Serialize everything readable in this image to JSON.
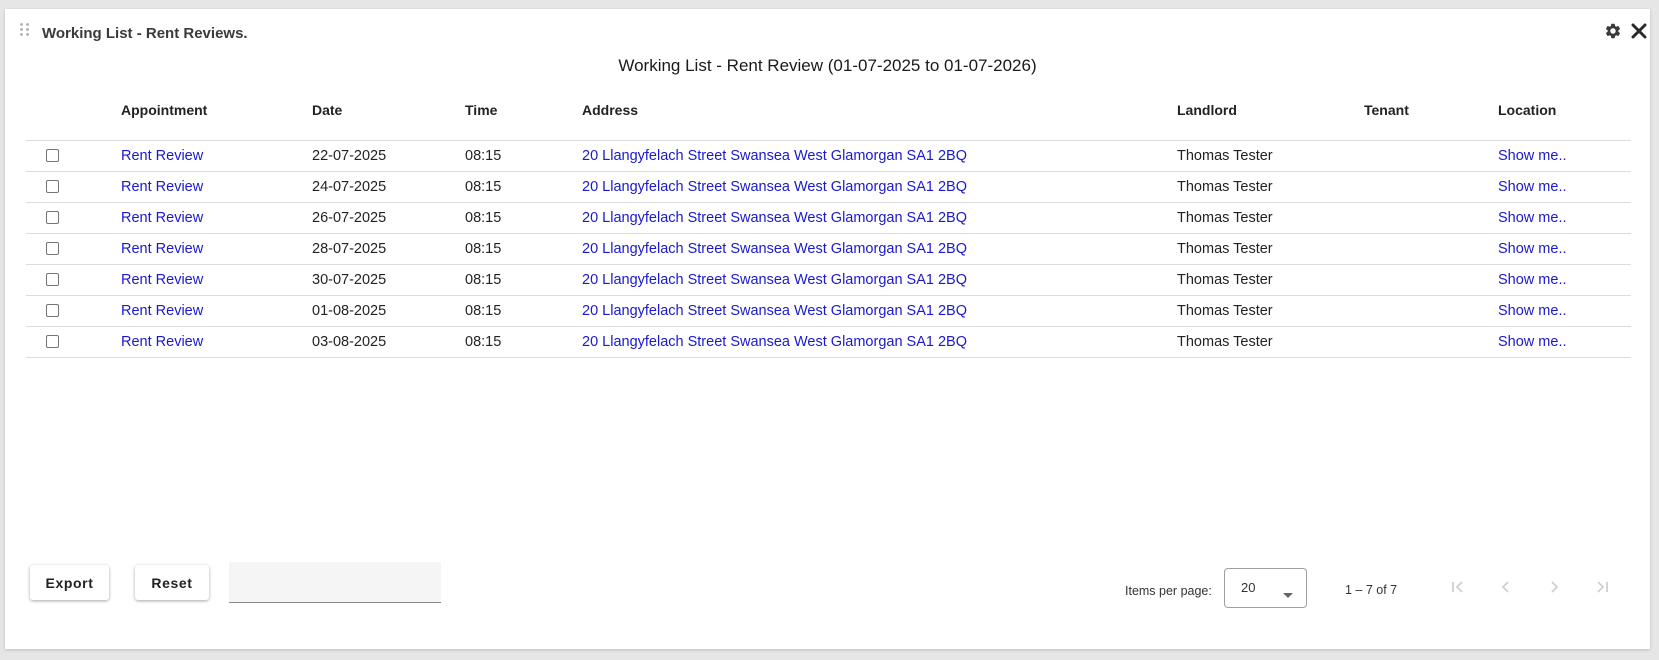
{
  "widget": {
    "title": "Working List - Rent Reviews.",
    "icons": {
      "settings": "gear-icon",
      "close": "close-icon",
      "drag": "drag-handle-icon"
    }
  },
  "table": {
    "title": "Working List - Rent Review (01-07-2025 to 01-07-2026)",
    "columns": {
      "appointment": "Appointment",
      "date": "Date",
      "time": "Time",
      "address": "Address",
      "landlord": "Landlord",
      "tenant": "Tenant",
      "location": "Location"
    },
    "rows": [
      {
        "appointment": "Rent Review",
        "date": "22-07-2025",
        "time": "08:15",
        "address": "20 Llangyfelach Street Swansea West Glamorgan SA1 2BQ",
        "landlord": "Thomas Tester",
        "tenant": "",
        "location": "Show me.."
      },
      {
        "appointment": "Rent Review",
        "date": "24-07-2025",
        "time": "08:15",
        "address": "20 Llangyfelach Street Swansea West Glamorgan SA1 2BQ",
        "landlord": "Thomas Tester",
        "tenant": "",
        "location": "Show me.."
      },
      {
        "appointment": "Rent Review",
        "date": "26-07-2025",
        "time": "08:15",
        "address": "20 Llangyfelach Street Swansea West Glamorgan SA1 2BQ",
        "landlord": "Thomas Tester",
        "tenant": "",
        "location": "Show me.."
      },
      {
        "appointment": "Rent Review",
        "date": "28-07-2025",
        "time": "08:15",
        "address": "20 Llangyfelach Street Swansea West Glamorgan SA1 2BQ",
        "landlord": "Thomas Tester",
        "tenant": "",
        "location": "Show me.."
      },
      {
        "appointment": "Rent Review",
        "date": "30-07-2025",
        "time": "08:15",
        "address": "20 Llangyfelach Street Swansea West Glamorgan SA1 2BQ",
        "landlord": "Thomas Tester",
        "tenant": "",
        "location": "Show me.."
      },
      {
        "appointment": "Rent Review",
        "date": "01-08-2025",
        "time": "08:15",
        "address": "20 Llangyfelach Street Swansea West Glamorgan SA1 2BQ",
        "landlord": "Thomas Tester",
        "tenant": "",
        "location": "Show me.."
      },
      {
        "appointment": "Rent Review",
        "date": "03-08-2025",
        "time": "08:15",
        "address": "20 Llangyfelach Street Swansea West Glamorgan SA1 2BQ",
        "landlord": "Thomas Tester",
        "tenant": "",
        "location": "Show me.."
      }
    ]
  },
  "footer": {
    "export_label": "Export",
    "reset_label": "Reset",
    "filter_value": "",
    "items_per_page_label": "Items per page:",
    "items_per_page_value": "20",
    "range_label": "1 – 7 of 7"
  },
  "colors": {
    "link": "#1a1acc",
    "divider": "#dcdcdc",
    "page_background": "#e6e6e6",
    "card_background": "#ffffff"
  }
}
